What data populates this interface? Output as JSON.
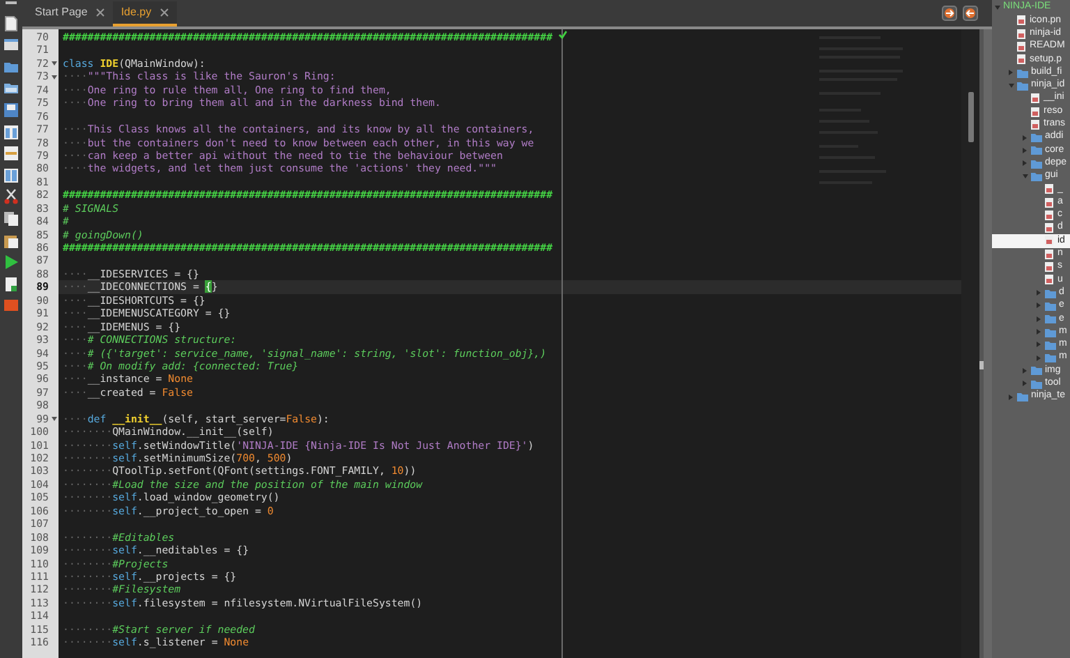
{
  "tabs": [
    {
      "label": "Start Page",
      "selected": false
    },
    {
      "label": "Ide.py",
      "selected": true
    }
  ],
  "editor": {
    "lines": [
      {
        "number": "70",
        "current": false,
        "fold": false,
        "tokens": [
          {
            "kind": "hash",
            "text": "###############################################################################"
          }
        ]
      },
      {
        "number": "71",
        "current": false,
        "fold": false
      },
      {
        "number": "72",
        "current": false,
        "fold": true,
        "tokens": [
          {
            "kind": "kw",
            "text": "class "
          },
          {
            "kind": "name",
            "text": "IDE"
          },
          {
            "kind": "plain",
            "text": "(QMainWindow):"
          }
        ]
      },
      {
        "number": "73",
        "current": false,
        "fold": true,
        "tokens": [
          {
            "kind": "ws",
            "text": "····"
          },
          {
            "kind": "str",
            "text": "\"\"\"This class is like the Sauron's Ring:"
          }
        ]
      },
      {
        "number": "74",
        "current": false,
        "fold": false,
        "tokens": [
          {
            "kind": "ws",
            "text": "····"
          },
          {
            "kind": "str",
            "text": "One ring to rule them all, One ring to find them,"
          }
        ]
      },
      {
        "number": "75",
        "current": false,
        "fold": false,
        "tokens": [
          {
            "kind": "ws",
            "text": "····"
          },
          {
            "kind": "str",
            "text": "One ring to bring them all and in the darkness bind them."
          }
        ]
      },
      {
        "number": "76",
        "current": false,
        "fold": false
      },
      {
        "number": "77",
        "current": false,
        "fold": false,
        "tokens": [
          {
            "kind": "ws",
            "text": "····"
          },
          {
            "kind": "str",
            "text": "This Class knows all the containers, and its know by all the containers,"
          }
        ]
      },
      {
        "number": "78",
        "current": false,
        "fold": false,
        "tokens": [
          {
            "kind": "ws",
            "text": "····"
          },
          {
            "kind": "str",
            "text": "but the containers don't need to know between each other, in this way we"
          }
        ]
      },
      {
        "number": "79",
        "current": false,
        "fold": false,
        "tokens": [
          {
            "kind": "ws",
            "text": "····"
          },
          {
            "kind": "str",
            "text": "can keep a better api without the need to tie the behaviour between"
          }
        ]
      },
      {
        "number": "80",
        "current": false,
        "fold": false,
        "tokens": [
          {
            "kind": "ws",
            "text": "····"
          },
          {
            "kind": "str",
            "text": "the widgets, and let them just consume the 'actions' they need.\"\"\""
          }
        ]
      },
      {
        "number": "81",
        "current": false,
        "fold": false
      },
      {
        "number": "82",
        "current": false,
        "fold": false,
        "tokens": [
          {
            "kind": "hash",
            "text": "###############################################################################"
          }
        ]
      },
      {
        "number": "83",
        "current": false,
        "fold": false,
        "tokens": [
          {
            "kind": "com",
            "text": "# SIGNALS"
          }
        ]
      },
      {
        "number": "84",
        "current": false,
        "fold": false,
        "tokens": [
          {
            "kind": "com",
            "text": "#"
          }
        ]
      },
      {
        "number": "85",
        "current": false,
        "fold": false,
        "tokens": [
          {
            "kind": "com",
            "text": "# goingDown()"
          }
        ]
      },
      {
        "number": "86",
        "current": false,
        "fold": false,
        "tokens": [
          {
            "kind": "hash",
            "text": "###############################################################################"
          }
        ]
      },
      {
        "number": "87",
        "current": false,
        "fold": false
      },
      {
        "number": "88",
        "current": false,
        "fold": false,
        "tokens": [
          {
            "kind": "ws",
            "text": "····"
          },
          {
            "kind": "plain",
            "text": "__IDESERVICES = {}"
          }
        ]
      },
      {
        "number": "89",
        "current": true,
        "fold": false,
        "tokens": [
          {
            "kind": "ws",
            "text": "····"
          },
          {
            "kind": "plain",
            "text": "__IDECONNECTIONS = "
          },
          {
            "kind": "match",
            "text": "{"
          },
          {
            "kind": "plain",
            "text": "}"
          }
        ]
      },
      {
        "number": "90",
        "current": false,
        "fold": false,
        "tokens": [
          {
            "kind": "ws",
            "text": "····"
          },
          {
            "kind": "plain",
            "text": "__IDESHORTCUTS = {}"
          }
        ]
      },
      {
        "number": "91",
        "current": false,
        "fold": false,
        "tokens": [
          {
            "kind": "ws",
            "text": "····"
          },
          {
            "kind": "plain",
            "text": "__IDEMENUSCATEGORY = {}"
          }
        ]
      },
      {
        "number": "92",
        "current": false,
        "fold": false,
        "tokens": [
          {
            "kind": "ws",
            "text": "····"
          },
          {
            "kind": "plain",
            "text": "__IDEMENUS = {}"
          }
        ]
      },
      {
        "number": "93",
        "current": false,
        "fold": false,
        "tokens": [
          {
            "kind": "ws",
            "text": "····"
          },
          {
            "kind": "com",
            "text": "# CONNECTIONS structure:"
          }
        ]
      },
      {
        "number": "94",
        "current": false,
        "fold": false,
        "tokens": [
          {
            "kind": "ws",
            "text": "····"
          },
          {
            "kind": "com",
            "text": "# ({'target': service_name, 'signal_name': string, 'slot': function_obj},)"
          }
        ]
      },
      {
        "number": "95",
        "current": false,
        "fold": false,
        "tokens": [
          {
            "kind": "ws",
            "text": "····"
          },
          {
            "kind": "com",
            "text": "# On modify add: {connected: True}"
          }
        ]
      },
      {
        "number": "96",
        "current": false,
        "fold": false,
        "tokens": [
          {
            "kind": "ws",
            "text": "····"
          },
          {
            "kind": "plain",
            "text": "__instance = "
          },
          {
            "kind": "const",
            "text": "None"
          }
        ]
      },
      {
        "number": "97",
        "current": false,
        "fold": false,
        "tokens": [
          {
            "kind": "ws",
            "text": "····"
          },
          {
            "kind": "plain",
            "text": "__created = "
          },
          {
            "kind": "const",
            "text": "False"
          }
        ]
      },
      {
        "number": "98",
        "current": false,
        "fold": false
      },
      {
        "number": "99",
        "current": false,
        "fold": true,
        "tokens": [
          {
            "kind": "ws",
            "text": "····"
          },
          {
            "kind": "kw",
            "text": "def "
          },
          {
            "kind": "name",
            "text": "__init__"
          },
          {
            "kind": "plain",
            "text": "(self, start_server="
          },
          {
            "kind": "const",
            "text": "False"
          },
          {
            "kind": "plain",
            "text": "):"
          }
        ]
      },
      {
        "number": "100",
        "current": false,
        "fold": false,
        "tokens": [
          {
            "kind": "ws",
            "text": "········"
          },
          {
            "kind": "plain",
            "text": "QMainWindow.__init__(self)"
          }
        ]
      },
      {
        "number": "101",
        "current": false,
        "fold": false,
        "tokens": [
          {
            "kind": "ws",
            "text": "········"
          },
          {
            "kind": "kw",
            "text": "self"
          },
          {
            "kind": "plain",
            "text": ".setWindowTitle("
          },
          {
            "kind": "str",
            "text": "'NINJA-IDE {Ninja-IDE Is Not Just Another IDE}'"
          },
          {
            "kind": "plain",
            "text": ")"
          }
        ]
      },
      {
        "number": "102",
        "current": false,
        "fold": false,
        "tokens": [
          {
            "kind": "ws",
            "text": "········"
          },
          {
            "kind": "kw",
            "text": "self"
          },
          {
            "kind": "plain",
            "text": ".setMinimumSize("
          },
          {
            "kind": "const",
            "text": "700"
          },
          {
            "kind": "plain",
            "text": ", "
          },
          {
            "kind": "const",
            "text": "500"
          },
          {
            "kind": "plain",
            "text": ")"
          }
        ]
      },
      {
        "number": "103",
        "current": false,
        "fold": false,
        "tokens": [
          {
            "kind": "ws",
            "text": "········"
          },
          {
            "kind": "plain",
            "text": "QToolTip.setFont(QFont(settings.FONT_FAMILY, "
          },
          {
            "kind": "const",
            "text": "10"
          },
          {
            "kind": "plain",
            "text": "))"
          }
        ]
      },
      {
        "number": "104",
        "current": false,
        "fold": false,
        "tokens": [
          {
            "kind": "ws",
            "text": "········"
          },
          {
            "kind": "com",
            "text": "#Load the size and the position of the main window"
          }
        ]
      },
      {
        "number": "105",
        "current": false,
        "fold": false,
        "tokens": [
          {
            "kind": "ws",
            "text": "········"
          },
          {
            "kind": "kw",
            "text": "self"
          },
          {
            "kind": "plain",
            "text": ".load_window_geometry()"
          }
        ]
      },
      {
        "number": "106",
        "current": false,
        "fold": false,
        "tokens": [
          {
            "kind": "ws",
            "text": "········"
          },
          {
            "kind": "kw",
            "text": "self"
          },
          {
            "kind": "plain",
            "text": ".__project_to_open = "
          },
          {
            "kind": "const",
            "text": "0"
          }
        ]
      },
      {
        "number": "107",
        "current": false,
        "fold": false
      },
      {
        "number": "108",
        "current": false,
        "fold": false,
        "tokens": [
          {
            "kind": "ws",
            "text": "········"
          },
          {
            "kind": "com",
            "text": "#Editables"
          }
        ]
      },
      {
        "number": "109",
        "current": false,
        "fold": false,
        "tokens": [
          {
            "kind": "ws",
            "text": "········"
          },
          {
            "kind": "kw",
            "text": "self"
          },
          {
            "kind": "plain",
            "text": ".__neditables = {}"
          }
        ]
      },
      {
        "number": "110",
        "current": false,
        "fold": false,
        "tokens": [
          {
            "kind": "ws",
            "text": "········"
          },
          {
            "kind": "com",
            "text": "#Projects"
          }
        ]
      },
      {
        "number": "111",
        "current": false,
        "fold": false,
        "tokens": [
          {
            "kind": "ws",
            "text": "········"
          },
          {
            "kind": "kw",
            "text": "self"
          },
          {
            "kind": "plain",
            "text": ".__projects = {}"
          }
        ]
      },
      {
        "number": "112",
        "current": false,
        "fold": false,
        "tokens": [
          {
            "kind": "ws",
            "text": "········"
          },
          {
            "kind": "com",
            "text": "#Filesystem"
          }
        ]
      },
      {
        "number": "113",
        "current": false,
        "fold": false,
        "tokens": [
          {
            "kind": "ws",
            "text": "········"
          },
          {
            "kind": "kw",
            "text": "self"
          },
          {
            "kind": "plain",
            "text": ".filesystem = nfilesystem.NVirtualFileSystem()"
          }
        ]
      },
      {
        "number": "114",
        "current": false,
        "fold": false
      },
      {
        "number": "115",
        "current": false,
        "fold": false,
        "tokens": [
          {
            "kind": "ws",
            "text": "········"
          },
          {
            "kind": "com",
            "text": "#Start server if needed"
          }
        ]
      },
      {
        "number": "116",
        "current": false,
        "fold": false,
        "tokens": [
          {
            "kind": "ws",
            "text": "········"
          },
          {
            "kind": "kw",
            "text": "self"
          },
          {
            "kind": "plain",
            "text": ".s_listener = "
          },
          {
            "kind": "const",
            "text": "None"
          }
        ]
      }
    ]
  },
  "project_tree": [
    {
      "label": "NINJA-IDE",
      "kind": "project",
      "expanded": true,
      "selected": false,
      "children": [
        {
          "label": "icon.pn",
          "kind": "file",
          "selected": false
        },
        {
          "label": "ninja-id",
          "kind": "file",
          "selected": false
        },
        {
          "label": "READM",
          "kind": "file",
          "selected": false
        },
        {
          "label": "setup.p",
          "kind": "file",
          "selected": false
        },
        {
          "label": "build_fi",
          "kind": "folder",
          "expanded": false,
          "selected": false
        },
        {
          "label": "ninja_id",
          "kind": "folder",
          "expanded": true,
          "selected": false,
          "children": [
            {
              "label": "__ini",
              "kind": "file",
              "selected": false
            },
            {
              "label": "reso",
              "kind": "file",
              "selected": false
            },
            {
              "label": "trans",
              "kind": "file",
              "selected": false
            },
            {
              "label": "addi",
              "kind": "folder",
              "expanded": false,
              "selected": false
            },
            {
              "label": "core",
              "kind": "folder",
              "expanded": false,
              "selected": false
            },
            {
              "label": "depe",
              "kind": "folder",
              "expanded": false,
              "selected": false
            },
            {
              "label": "gui",
              "kind": "folder",
              "expanded": true,
              "selected": false,
              "children": [
                {
                  "label": "_",
                  "kind": "file",
                  "selected": false
                },
                {
                  "label": "a",
                  "kind": "file",
                  "selected": false
                },
                {
                  "label": "c",
                  "kind": "file",
                  "selected": false
                },
                {
                  "label": "d",
                  "kind": "file",
                  "selected": false
                },
                {
                  "label": "id",
                  "kind": "file",
                  "selected": true
                },
                {
                  "label": "n",
                  "kind": "file",
                  "selected": false
                },
                {
                  "label": "s",
                  "kind": "file",
                  "selected": false
                },
                {
                  "label": "u",
                  "kind": "file",
                  "selected": false
                },
                {
                  "label": "d",
                  "kind": "folder",
                  "expanded": false,
                  "selected": false
                },
                {
                  "label": "e",
                  "kind": "folder",
                  "expanded": false,
                  "selected": false
                },
                {
                  "label": "e",
                  "kind": "folder",
                  "expanded": false,
                  "selected": false
                },
                {
                  "label": "m",
                  "kind": "folder",
                  "expanded": false,
                  "selected": false
                },
                {
                  "label": "m",
                  "kind": "folder",
                  "expanded": false,
                  "selected": false
                },
                {
                  "label": "m",
                  "kind": "folder",
                  "expanded": false,
                  "selected": false
                }
              ]
            },
            {
              "label": "img",
              "kind": "folder",
              "expanded": false,
              "selected": false
            },
            {
              "label": "tool",
              "kind": "folder",
              "expanded": false,
              "selected": false
            }
          ]
        },
        {
          "label": "ninja_te",
          "kind": "folder",
          "expanded": false,
          "selected": false
        }
      ]
    }
  ]
}
